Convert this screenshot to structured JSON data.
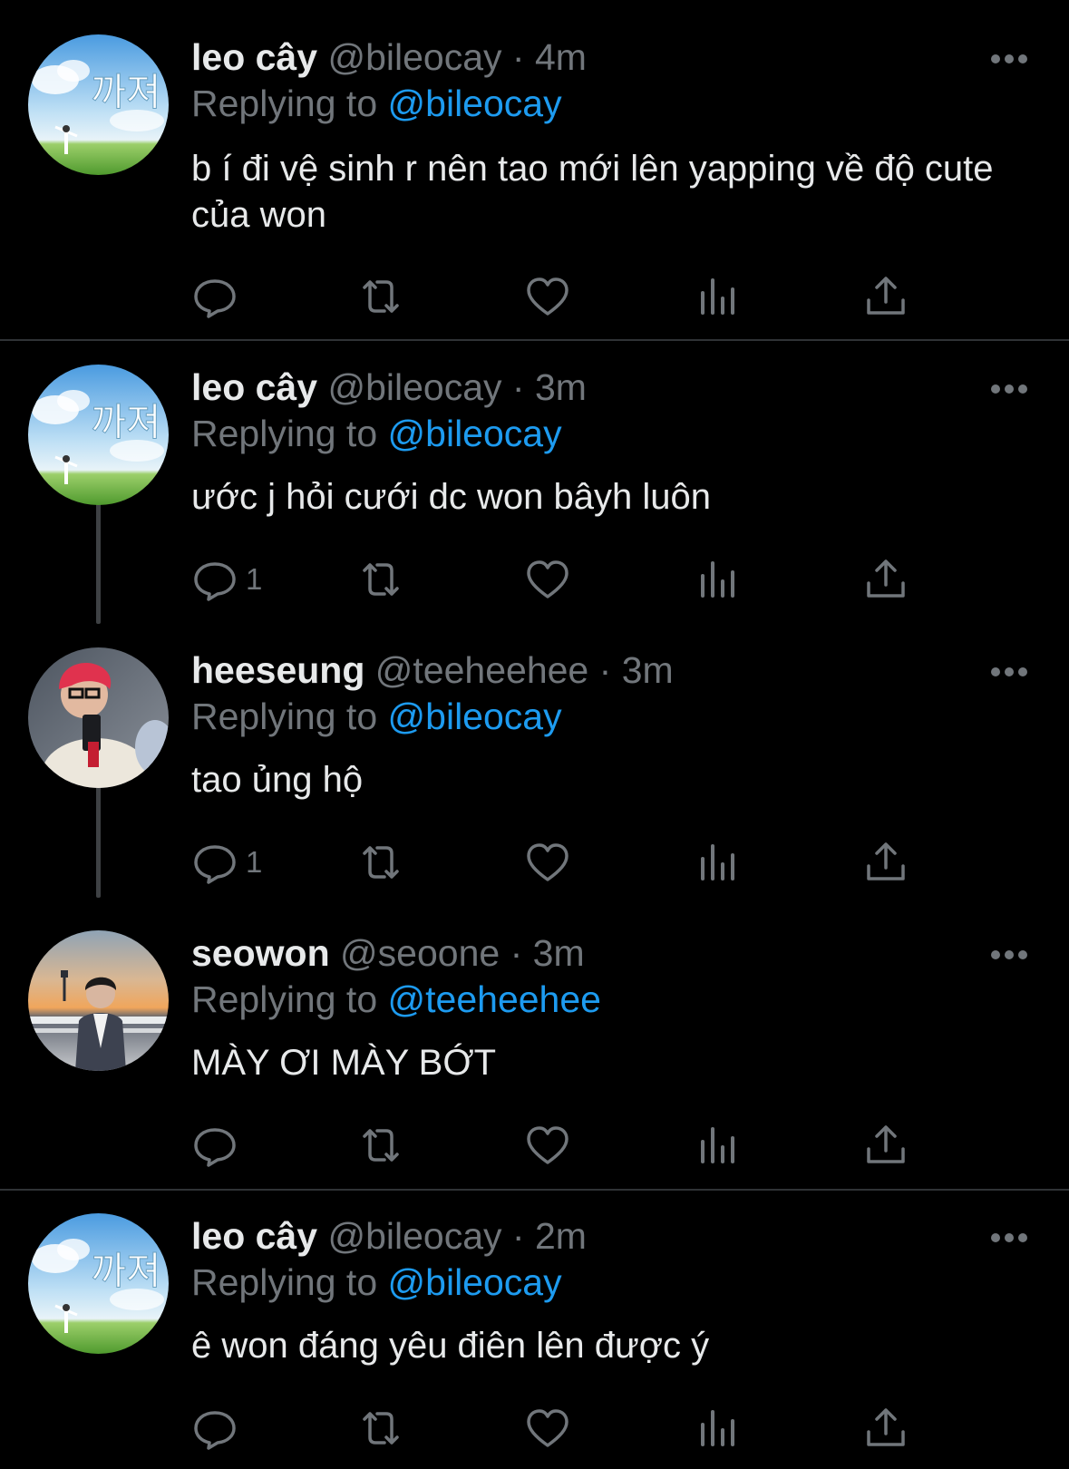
{
  "tweets": [
    {
      "display_name": "leo cây",
      "handle": "@bileocay",
      "separator": "·",
      "time": "4m",
      "replying_prefix": "Replying to",
      "replying_to": "@bileocay",
      "text": "b í đi vệ sinh r nên tao mới lên yapping về độ cute của won",
      "reply_count": "",
      "avatar": "sky-avatar-icon"
    },
    {
      "display_name": "leo cây",
      "handle": "@bileocay",
      "separator": "·",
      "time": "3m",
      "replying_prefix": "Replying to",
      "replying_to": "@bileocay",
      "text": "ước j hỏi cưới dc won bâyh luôn",
      "reply_count": "1",
      "avatar": "sky-avatar-icon"
    },
    {
      "display_name": "heeseung",
      "handle": "@teeheehee",
      "separator": "·",
      "time": "3m",
      "replying_prefix": "Replying to",
      "replying_to": "@bileocay",
      "text": "tao ủng hộ",
      "reply_count": "1",
      "avatar": "red-hair-selfie-avatar-icon"
    },
    {
      "display_name": "seowon",
      "handle": "@seoone",
      "separator": "·",
      "time": "3m",
      "replying_prefix": "Replying to",
      "replying_to": "@teeheehee",
      "text": "MÀY ƠI MÀY BỚT",
      "reply_count": "",
      "avatar": "sunset-tower-avatar-icon"
    },
    {
      "display_name": "leo cây",
      "handle": "@bileocay",
      "separator": "·",
      "time": "2m",
      "replying_prefix": "Replying to",
      "replying_to": "@bileocay",
      "text": "ê won đáng yêu điên lên được ý",
      "reply_count": "",
      "avatar": "sky-avatar-icon"
    }
  ],
  "icons": {
    "reply": "reply-icon",
    "retweet": "retweet-icon",
    "like": "heart-icon",
    "views": "views-chart-icon",
    "share": "share-icon",
    "more": "more-options-icon"
  },
  "colors": {
    "background": "#000000",
    "primary_text": "#e7e9ea",
    "secondary_text": "#71767b",
    "link": "#1d9bf0",
    "divider": "#2f3336",
    "thread_line": "#3e4144"
  }
}
